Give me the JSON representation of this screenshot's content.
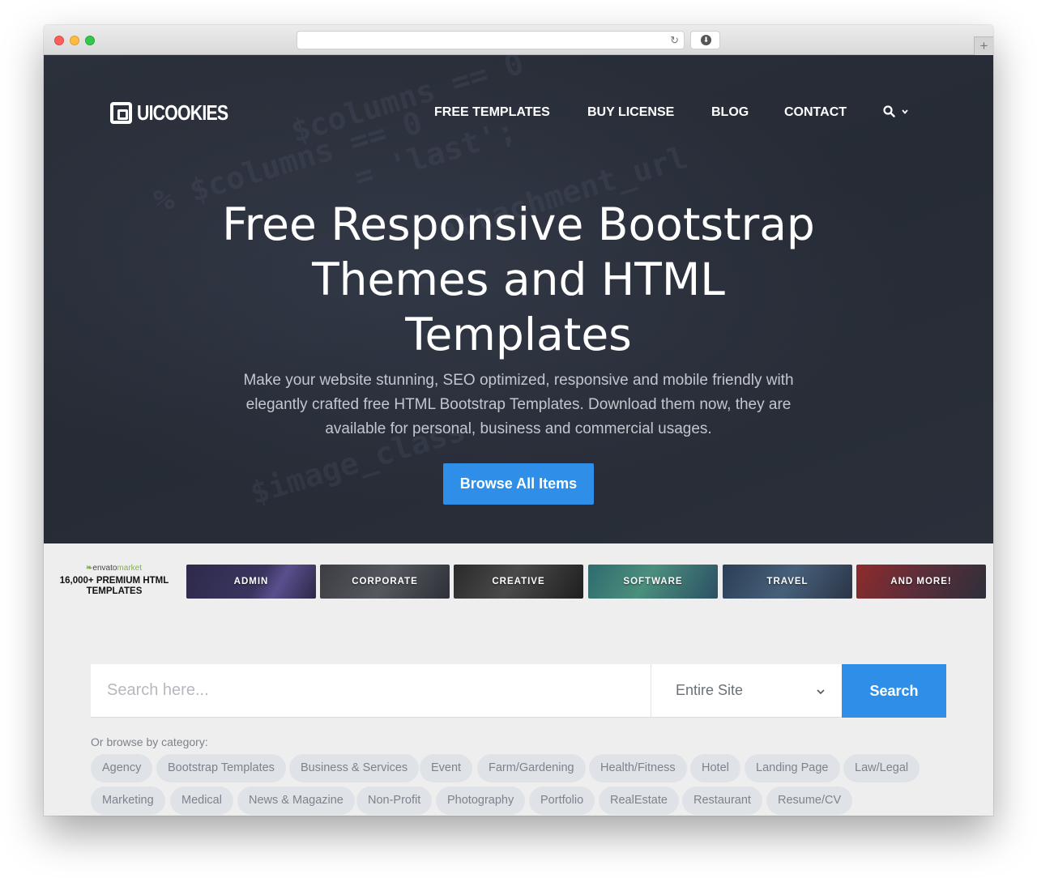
{
  "browser": {
    "url": "",
    "reload_icon": "reload-icon",
    "download_icon": "download-icon",
    "new_tab_icon": "plus-icon",
    "new_tab_symbol": "+"
  },
  "site": {
    "logo_text": "UICOOKIES",
    "nav": [
      "FREE TEMPLATES",
      "BUY LICENSE",
      "BLOG",
      "CONTACT"
    ],
    "search_icon": "search-icon"
  },
  "hero": {
    "title": "Free Responsive Bootstrap Themes and HTML Templates",
    "subtitle": "Make your website stunning, SEO optimized, responsive and mobile friendly with elegantly crafted free HTML Bootstrap Templates. Download them now, they are available for personal, business and commercial usages.",
    "cta_label": "Browse All Items",
    "background_code": [
      "$columns == 0",
      "% $columns == 0",
      "= 'last';",
      "attachment_url",
      "$image_class"
    ]
  },
  "envato": {
    "brand": "envato",
    "brand_suffix": "market",
    "tagline": "16,000+ PREMIUM HTML TEMPLATES",
    "tiles": [
      "ADMIN",
      "CORPORATE",
      "CREATIVE",
      "SOFTWARE",
      "TRAVEL",
      "AND MORE!"
    ]
  },
  "search": {
    "placeholder": "Search here...",
    "scope_value": "Entire Site",
    "button_label": "Search"
  },
  "categories": {
    "label": "Or browse by category:",
    "row1": [
      "Agency",
      "Bootstrap Templates",
      "Business & Services",
      "Event",
      "Farm/Gardening",
      "Health/Fitness",
      "Hotel",
      "Landing Page",
      "Law/Legal"
    ],
    "row2": [
      "Marketing",
      "Medical",
      "News & Magazine",
      "Non-Profit",
      "Photography",
      "Portfolio",
      "RealEstate",
      "Restaurant",
      "Resume/CV"
    ]
  },
  "colors": {
    "accent": "#2f8fe8",
    "hero_bg": "#282d37",
    "page_bg": "#eeeeee",
    "tag_bg": "#dfe3e8"
  }
}
